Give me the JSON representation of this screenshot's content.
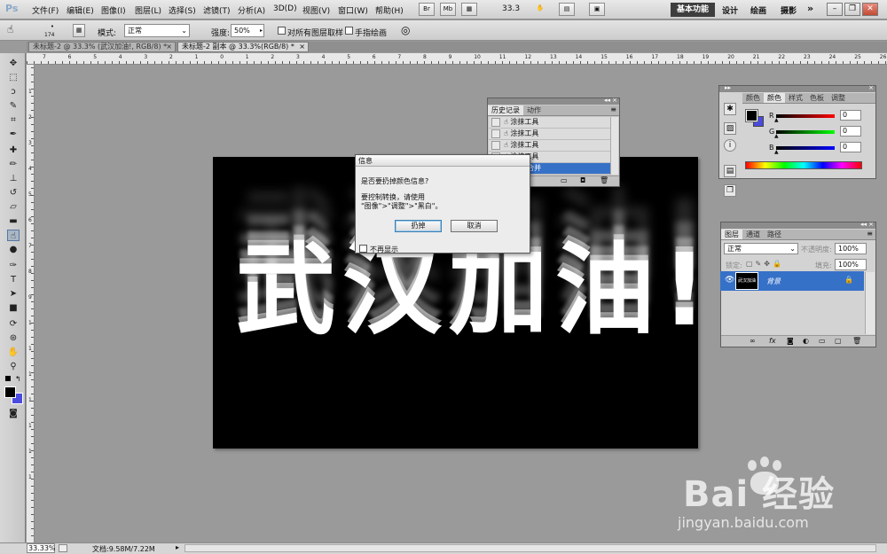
{
  "app": {
    "logo": "Ps"
  },
  "menu": [
    "文件(F)",
    "编辑(E)",
    "图像(I)",
    "图层(L)",
    "选择(S)",
    "滤镜(T)",
    "分析(A)",
    "3D(D)",
    "视图(V)",
    "窗口(W)",
    "帮助(H)"
  ],
  "menubar_extras": {
    "zoom": "33.3",
    "workspaces": [
      "基本功能",
      "设计",
      "绘画",
      "摄影"
    ],
    "more": "»"
  },
  "options": {
    "brush_size": "174",
    "mode_label": "模式:",
    "mode_value": "正常",
    "strength_label": "强度:",
    "strength_value": "50%",
    "sample_all": "对所有图层取样",
    "finger_paint": "手指绘画"
  },
  "tabs": [
    "未标题-2 @ 33.3% (武汉加油!, RGB/8) *",
    "未标题-2 副本 @ 33.3%(RGB/8) *"
  ],
  "ruler": {
    "top": [
      "7",
      "6",
      "5",
      "4",
      "3",
      "2",
      "1",
      "0",
      "1",
      "2",
      "3",
      "4",
      "5",
      "6",
      "7",
      "8",
      "9",
      "10",
      "11",
      "12",
      "13",
      "14",
      "15",
      "16",
      "17",
      "18",
      "19",
      "20",
      "21",
      "22",
      "23",
      "24",
      "25",
      "26"
    ],
    "left": [
      "1",
      "2",
      "3",
      "4",
      "5",
      "6",
      "7",
      "8",
      "9",
      "1",
      "1",
      "1",
      "1",
      "1",
      "1",
      "1"
    ]
  },
  "canvas": {
    "text": "武汉加油!"
  },
  "history": {
    "tabs": [
      "历史记录",
      "动作"
    ],
    "items": [
      "涂抹工具",
      "涂抹工具",
      "涂抹工具",
      "涂抹工具",
      "向下合并"
    ]
  },
  "dialog": {
    "title": "信息",
    "question": "是否要扔掉颜色信息?",
    "line1": "要控制转换，请使用",
    "line2": "\"图像\">\"调整\">\"黑白\"。",
    "ok": "扔掉",
    "cancel": "取消",
    "dont_show": "不再显示"
  },
  "color_panel": {
    "tabs": [
      "颜色",
      "色板",
      "样式",
      "色板",
      "调整"
    ],
    "channels": [
      {
        "label": "R",
        "value": "0"
      },
      {
        "label": "G",
        "value": "0"
      },
      {
        "label": "B",
        "value": "0"
      }
    ]
  },
  "layers_panel": {
    "tabs": [
      "图层",
      "通道",
      "路径"
    ],
    "blend": "正常",
    "opacity_label": "不透明度:",
    "opacity": "100%",
    "lock_label": "锁定:",
    "fill_label": "填充:",
    "fill": "100%",
    "layer_name": "背景",
    "thumb_text": "武汉加油"
  },
  "status": {
    "zoom": "33.33%",
    "doc": "文档:9.58M/7.22M"
  },
  "watermark": {
    "brand": "Bai 经验",
    "url": "jingyan.baidu.com"
  },
  "colors": {
    "accent": "#3671c8",
    "canvas": "#000000",
    "background": "#9a9a9a"
  }
}
